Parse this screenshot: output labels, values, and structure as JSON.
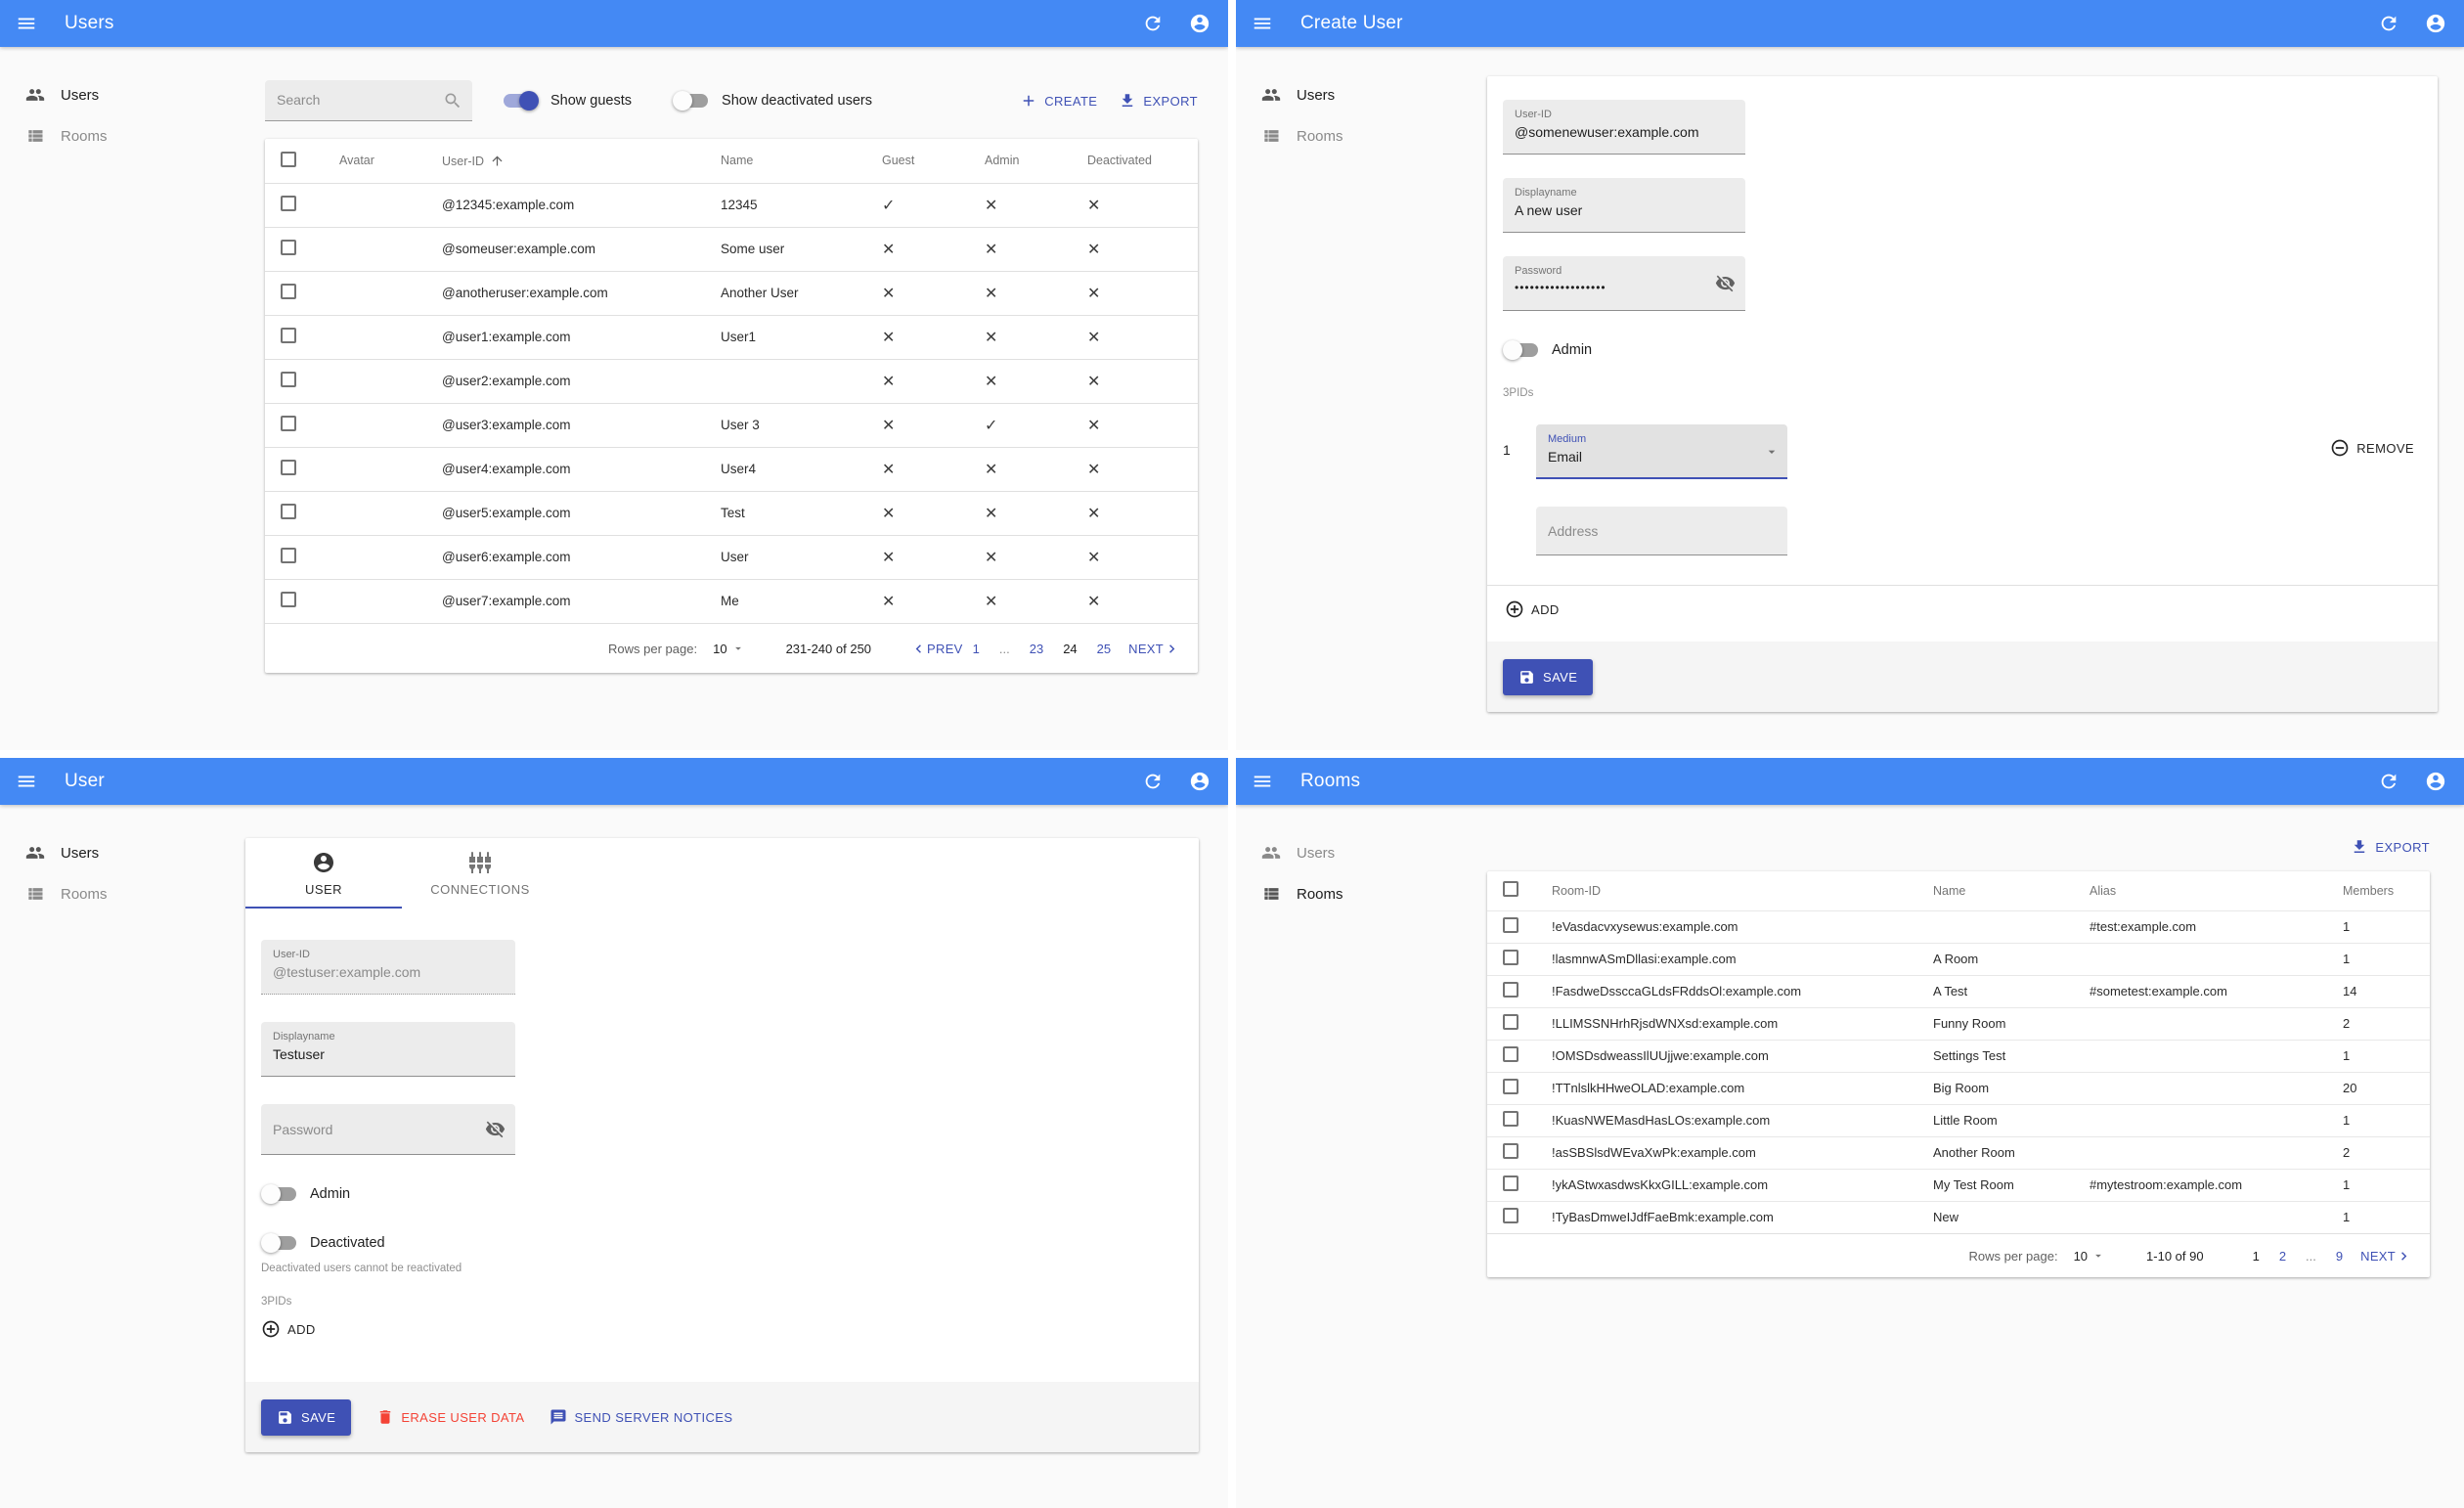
{
  "colors": {
    "appbar": "#4489f4",
    "primary": "#3f51b5",
    "danger": "#f44336"
  },
  "menu": {
    "users": "Users",
    "rooms": "Rooms"
  },
  "users_list": {
    "title": "Users",
    "search_placeholder": "Search",
    "show_guests_label": "Show guests",
    "show_deactivated_label": "Show deactivated users",
    "create_label": "CREATE",
    "export_label": "EXPORT",
    "columns": {
      "avatar": "Avatar",
      "user_id": "User-ID",
      "name": "Name",
      "guest": "Guest",
      "admin": "Admin",
      "deactivated": "Deactivated"
    },
    "rows": [
      {
        "user_id": "@12345:example.com",
        "name": "12345",
        "guest": true,
        "admin": false,
        "deactivated": false
      },
      {
        "user_id": "@someuser:example.com",
        "name": "Some user",
        "guest": false,
        "admin": false,
        "deactivated": false
      },
      {
        "user_id": "@anotheruser:example.com",
        "name": "Another User",
        "guest": false,
        "admin": false,
        "deactivated": false
      },
      {
        "user_id": "@user1:example.com",
        "name": "User1",
        "guest": false,
        "admin": false,
        "deactivated": false
      },
      {
        "user_id": "@user2:example.com",
        "name": "",
        "guest": false,
        "admin": false,
        "deactivated": false
      },
      {
        "user_id": "@user3:example.com",
        "name": "User 3",
        "guest": false,
        "admin": true,
        "deactivated": false
      },
      {
        "user_id": "@user4:example.com",
        "name": "User4",
        "guest": false,
        "admin": false,
        "deactivated": false
      },
      {
        "user_id": "@user5:example.com",
        "name": "Test",
        "guest": false,
        "admin": false,
        "deactivated": false
      },
      {
        "user_id": "@user6:example.com",
        "name": "User",
        "guest": false,
        "admin": false,
        "deactivated": false
      },
      {
        "user_id": "@user7:example.com",
        "name": "Me",
        "guest": false,
        "admin": false,
        "deactivated": false
      }
    ],
    "pagination": {
      "rows_per_page_label": "Rows per page:",
      "rows_per_page": "10",
      "range": "231-240 of 250",
      "prev_label": "PREV",
      "next_label": "NEXT",
      "pages": [
        {
          "label": "1",
          "type": "link"
        },
        {
          "label": "...",
          "type": "ellipsis"
        },
        {
          "label": "23",
          "type": "link"
        },
        {
          "label": "24",
          "type": "current"
        },
        {
          "label": "25",
          "type": "link"
        }
      ]
    }
  },
  "create_user": {
    "title": "Create User",
    "user_id": {
      "label": "User-ID",
      "value": "@somenewuser:example.com"
    },
    "displayname": {
      "label": "Displayname",
      "value": "A new user"
    },
    "password": {
      "label": "Password",
      "value": "••••••••••••••••••"
    },
    "admin_label": "Admin",
    "threepids_label": "3PIDs",
    "threepid_index": "1",
    "medium": {
      "label": "Medium",
      "value": "Email"
    },
    "address_placeholder": "Address",
    "remove_label": "REMOVE",
    "add_label": "ADD",
    "save_label": "SAVE"
  },
  "user_detail": {
    "title": "User",
    "tabs": {
      "user": "USER",
      "connections": "CONNECTIONS"
    },
    "user_id": {
      "label": "User-ID",
      "value": "@testuser:example.com"
    },
    "displayname": {
      "label": "Displayname",
      "value": "Testuser"
    },
    "password_placeholder": "Password",
    "admin_label": "Admin",
    "deactivated_label": "Deactivated",
    "deactivated_helper": "Deactivated users cannot be reactivated",
    "threepids_label": "3PIDs",
    "add_label": "ADD",
    "save_label": "SAVE",
    "erase_label": "ERASE USER DATA",
    "notices_label": "SEND SERVER NOTICES"
  },
  "rooms_list": {
    "title": "Rooms",
    "export_label": "EXPORT",
    "columns": {
      "room_id": "Room-ID",
      "name": "Name",
      "alias": "Alias",
      "members": "Members"
    },
    "rows": [
      {
        "room_id": "!eVasdacvxysewus:example.com",
        "name": "",
        "alias": "#test:example.com",
        "members": "1"
      },
      {
        "room_id": "!lasmnwASmDllasi:example.com",
        "name": "A Room",
        "alias": "",
        "members": "1"
      },
      {
        "room_id": "!FasdweDssccaGLdsFRddsOl:example.com",
        "name": "A Test",
        "alias": "#sometest:example.com",
        "members": "14"
      },
      {
        "room_id": "!LLIMSSNHrhRjsdWNXsd:example.com",
        "name": "Funny Room",
        "alias": "",
        "members": "2"
      },
      {
        "room_id": "!OMSDsdweassIlUUjjwe:example.com",
        "name": "Settings Test",
        "alias": "",
        "members": "1"
      },
      {
        "room_id": "!TTnlslkHHweOLAD:example.com",
        "name": "Big Room",
        "alias": "",
        "members": "20"
      },
      {
        "room_id": "!KuasNWEMasdHasLOs:example.com",
        "name": "Little Room",
        "alias": "",
        "members": "1"
      },
      {
        "room_id": "!asSBSlsdWEvaXwPk:example.com",
        "name": "Another Room",
        "alias": "",
        "members": "2"
      },
      {
        "room_id": "!ykAStwxasdwsKkxGILL:example.com",
        "name": "My Test Room",
        "alias": "#mytestroom:example.com",
        "members": "1"
      },
      {
        "room_id": "!TyBasDmweIJdfFaeBmk:example.com",
        "name": "New",
        "alias": "",
        "members": "1"
      }
    ],
    "pagination": {
      "rows_per_page_label": "Rows per page:",
      "rows_per_page": "10",
      "range": "1-10 of 90",
      "next_label": "NEXT",
      "pages": [
        {
          "label": "1",
          "type": "current"
        },
        {
          "label": "2",
          "type": "link"
        },
        {
          "label": "...",
          "type": "ellipsis"
        },
        {
          "label": "9",
          "type": "link"
        }
      ]
    }
  }
}
